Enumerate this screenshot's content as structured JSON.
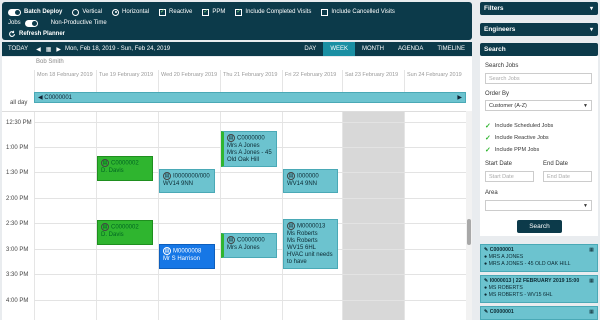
{
  "options": {
    "batch_deploy": "Batch Deploy",
    "vertical": "Vertical",
    "horizontal": "Horizontal",
    "reactive": "Reactive",
    "ppm": "PPM",
    "include_completed": "Include Completed Visits",
    "include_cancelled": "Include Cancelled Visits",
    "jobs": "Jobs",
    "non_productive": "Non-Productive Time",
    "refresh_planner": "Refresh Planner"
  },
  "nav": {
    "today": "TODAY",
    "range": "Mon, Feb 18, 2019 - Sun, Feb 24, 2019",
    "views": [
      "DAY",
      "WEEK",
      "MONTH",
      "AGENDA",
      "TIMELINE"
    ],
    "active_view": "WEEK"
  },
  "calendar": {
    "user": "Bob Smith",
    "days": [
      "Mon 18 February 2019",
      "Tue 19 February 2019",
      "Wed 20 February 2019",
      "Thu 21 February 2019",
      "Fri 22 February 2019",
      "Sat 23 February 2019",
      "Sun 24 February 2019"
    ],
    "allday_label": "all day",
    "allday_event": "C0000001",
    "hours": [
      "12:30 PM",
      "1:00 PM",
      "1:30 PM",
      "2:00 PM",
      "2:30 PM",
      "3:00 PM",
      "3:30 PM",
      "4:00 PM"
    ],
    "events": {
      "e1": {
        "id": "C0000002",
        "name": "D. Davis"
      },
      "e2": {
        "id": "I0000000/000",
        "name": "WV14 9NN"
      },
      "e3": {
        "id": "C0000000",
        "l1": "Mrs A Jones",
        "l2": "Mrs A Jones - 45",
        "l3": "Old Oak Hill"
      },
      "e4": {
        "id": "I000000",
        "name": "WV14 9NN"
      },
      "e5": {
        "id": "C0000002",
        "name": "D. Davis"
      },
      "e6": {
        "id": "C0000000",
        "name": "Mrs A Jones"
      },
      "e7": {
        "id": "M0000013",
        "l1": "Ms Roberts",
        "l2": "Ms Roberts",
        "l3": "WV15 6HL",
        "l4": "HVAC unit needs",
        "l5": "to have"
      },
      "e8": {
        "id": "M0000008",
        "name": "Mr S Harrison"
      }
    }
  },
  "panel": {
    "filters": "Filters",
    "engineers": "Engineers",
    "search": "Search",
    "search_jobs_label": "Search Jobs",
    "search_jobs_placeholder": "Search Jobs",
    "order_by_label": "Order By",
    "order_by_value": "Customer (A-Z)",
    "chk_scheduled": "Include Scheduled Jobs",
    "chk_reactive": "Include Reactive Jobs",
    "chk_ppm": "Include PPM Jobs",
    "start_date_label": "Start Date",
    "end_date_label": "End Date",
    "start_date_placeholder": "Start Date",
    "end_date_placeholder": "End Date",
    "area_label": "Area",
    "search_button": "Search"
  },
  "results": [
    {
      "title": "C0000001",
      "l1": "MRS A JONES",
      "l2": "MRS A JONES - 45 OLD OAK HILL"
    },
    {
      "title": "I0000013 | 22 FEBRUARY 2019 15:00",
      "l1": "MS ROBERTS",
      "l2": "MS ROBERTS - WV15 6HL"
    },
    {
      "title": "C0000001",
      "l1": "",
      "l2": ""
    }
  ]
}
